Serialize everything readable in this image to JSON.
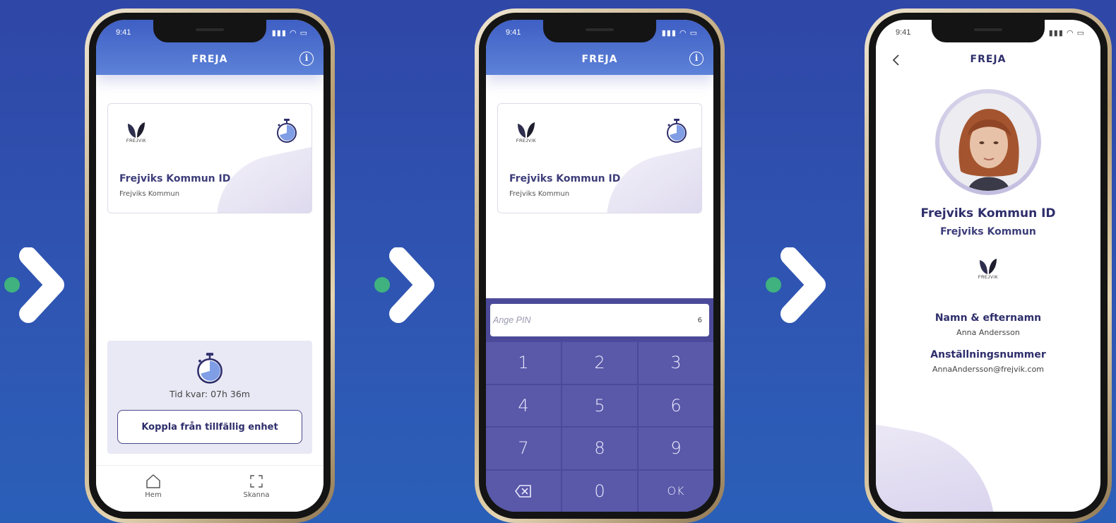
{
  "colors": {
    "accent_green": "#3fb27f",
    "brand_navy": "#2e2e6c",
    "header_blue": "#4a6bcc",
    "keypad": "#4b4a9a"
  },
  "status": {
    "time": "9:41"
  },
  "app": {
    "title": "FREJA",
    "info_icon": "info-icon"
  },
  "card": {
    "logo_text": "FREJVIK",
    "name": "Frejviks Kommun ID",
    "org": "Frejviks Kommun"
  },
  "phone1": {
    "time_left": "Tid kvar: 07h 36m",
    "disconnect_label": "Koppla från tillfällig enhet",
    "tabs": {
      "home": "Hem",
      "scan": "Skanna"
    }
  },
  "phone2": {
    "pin_placeholder": "Ange PIN",
    "pin_length": "6",
    "keys": [
      "1",
      "2",
      "3",
      "4",
      "5",
      "6",
      "7",
      "8",
      "9",
      "",
      "0",
      "OK"
    ]
  },
  "phone3": {
    "name": "Frejviks Kommun ID",
    "org": "Frejviks Kommun",
    "logo_text": "FREJVIK",
    "field1_label": "Namn & efternamn",
    "field1_value": "Anna Andersson",
    "field2_label": "Anställningsnummer",
    "field2_value": "AnnaAndersson@frejvik.com"
  }
}
